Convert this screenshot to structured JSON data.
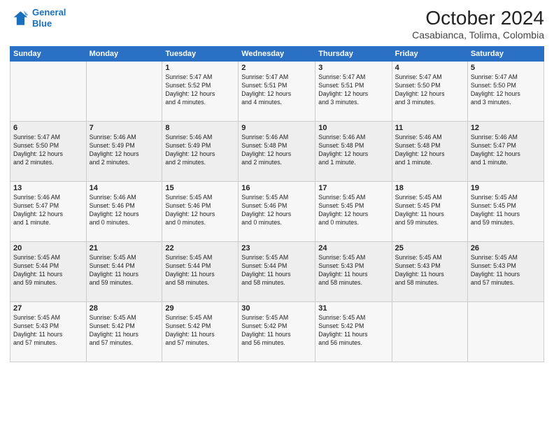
{
  "logo": {
    "line1": "General",
    "line2": "Blue"
  },
  "title": "October 2024",
  "subtitle": "Casabianca, Tolima, Colombia",
  "days_header": [
    "Sunday",
    "Monday",
    "Tuesday",
    "Wednesday",
    "Thursday",
    "Friday",
    "Saturday"
  ],
  "weeks": [
    [
      {
        "day": "",
        "info": ""
      },
      {
        "day": "",
        "info": ""
      },
      {
        "day": "1",
        "info": "Sunrise: 5:47 AM\nSunset: 5:52 PM\nDaylight: 12 hours\nand 4 minutes."
      },
      {
        "day": "2",
        "info": "Sunrise: 5:47 AM\nSunset: 5:51 PM\nDaylight: 12 hours\nand 4 minutes."
      },
      {
        "day": "3",
        "info": "Sunrise: 5:47 AM\nSunset: 5:51 PM\nDaylight: 12 hours\nand 3 minutes."
      },
      {
        "day": "4",
        "info": "Sunrise: 5:47 AM\nSunset: 5:50 PM\nDaylight: 12 hours\nand 3 minutes."
      },
      {
        "day": "5",
        "info": "Sunrise: 5:47 AM\nSunset: 5:50 PM\nDaylight: 12 hours\nand 3 minutes."
      }
    ],
    [
      {
        "day": "6",
        "info": "Sunrise: 5:47 AM\nSunset: 5:50 PM\nDaylight: 12 hours\nand 2 minutes."
      },
      {
        "day": "7",
        "info": "Sunrise: 5:46 AM\nSunset: 5:49 PM\nDaylight: 12 hours\nand 2 minutes."
      },
      {
        "day": "8",
        "info": "Sunrise: 5:46 AM\nSunset: 5:49 PM\nDaylight: 12 hours\nand 2 minutes."
      },
      {
        "day": "9",
        "info": "Sunrise: 5:46 AM\nSunset: 5:48 PM\nDaylight: 12 hours\nand 2 minutes."
      },
      {
        "day": "10",
        "info": "Sunrise: 5:46 AM\nSunset: 5:48 PM\nDaylight: 12 hours\nand 1 minute."
      },
      {
        "day": "11",
        "info": "Sunrise: 5:46 AM\nSunset: 5:48 PM\nDaylight: 12 hours\nand 1 minute."
      },
      {
        "day": "12",
        "info": "Sunrise: 5:46 AM\nSunset: 5:47 PM\nDaylight: 12 hours\nand 1 minute."
      }
    ],
    [
      {
        "day": "13",
        "info": "Sunrise: 5:46 AM\nSunset: 5:47 PM\nDaylight: 12 hours\nand 1 minute."
      },
      {
        "day": "14",
        "info": "Sunrise: 5:46 AM\nSunset: 5:46 PM\nDaylight: 12 hours\nand 0 minutes."
      },
      {
        "day": "15",
        "info": "Sunrise: 5:45 AM\nSunset: 5:46 PM\nDaylight: 12 hours\nand 0 minutes."
      },
      {
        "day": "16",
        "info": "Sunrise: 5:45 AM\nSunset: 5:46 PM\nDaylight: 12 hours\nand 0 minutes."
      },
      {
        "day": "17",
        "info": "Sunrise: 5:45 AM\nSunset: 5:45 PM\nDaylight: 12 hours\nand 0 minutes."
      },
      {
        "day": "18",
        "info": "Sunrise: 5:45 AM\nSunset: 5:45 PM\nDaylight: 11 hours\nand 59 minutes."
      },
      {
        "day": "19",
        "info": "Sunrise: 5:45 AM\nSunset: 5:45 PM\nDaylight: 11 hours\nand 59 minutes."
      }
    ],
    [
      {
        "day": "20",
        "info": "Sunrise: 5:45 AM\nSunset: 5:44 PM\nDaylight: 11 hours\nand 59 minutes."
      },
      {
        "day": "21",
        "info": "Sunrise: 5:45 AM\nSunset: 5:44 PM\nDaylight: 11 hours\nand 59 minutes."
      },
      {
        "day": "22",
        "info": "Sunrise: 5:45 AM\nSunset: 5:44 PM\nDaylight: 11 hours\nand 58 minutes."
      },
      {
        "day": "23",
        "info": "Sunrise: 5:45 AM\nSunset: 5:44 PM\nDaylight: 11 hours\nand 58 minutes."
      },
      {
        "day": "24",
        "info": "Sunrise: 5:45 AM\nSunset: 5:43 PM\nDaylight: 11 hours\nand 58 minutes."
      },
      {
        "day": "25",
        "info": "Sunrise: 5:45 AM\nSunset: 5:43 PM\nDaylight: 11 hours\nand 58 minutes."
      },
      {
        "day": "26",
        "info": "Sunrise: 5:45 AM\nSunset: 5:43 PM\nDaylight: 11 hours\nand 57 minutes."
      }
    ],
    [
      {
        "day": "27",
        "info": "Sunrise: 5:45 AM\nSunset: 5:43 PM\nDaylight: 11 hours\nand 57 minutes."
      },
      {
        "day": "28",
        "info": "Sunrise: 5:45 AM\nSunset: 5:42 PM\nDaylight: 11 hours\nand 57 minutes."
      },
      {
        "day": "29",
        "info": "Sunrise: 5:45 AM\nSunset: 5:42 PM\nDaylight: 11 hours\nand 57 minutes."
      },
      {
        "day": "30",
        "info": "Sunrise: 5:45 AM\nSunset: 5:42 PM\nDaylight: 11 hours\nand 56 minutes."
      },
      {
        "day": "31",
        "info": "Sunrise: 5:45 AM\nSunset: 5:42 PM\nDaylight: 11 hours\nand 56 minutes."
      },
      {
        "day": "",
        "info": ""
      },
      {
        "day": "",
        "info": ""
      }
    ]
  ]
}
